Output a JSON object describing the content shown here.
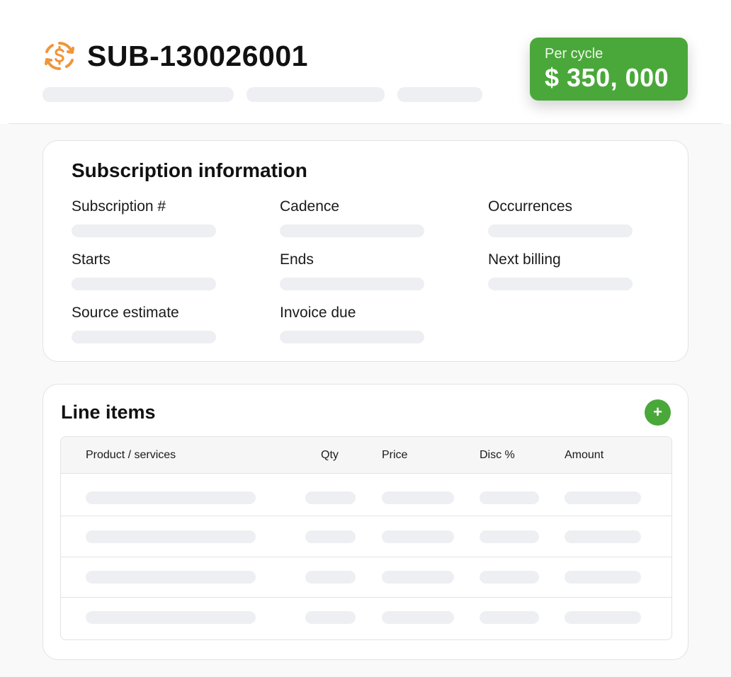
{
  "header": {
    "subscription_id": "SUB-130026001",
    "icon": "dollar-cycle-icon",
    "accent_color": "#f0953a"
  },
  "price_card": {
    "label": "Per cycle",
    "value": "$ 350, 000",
    "color": "#4aa83a"
  },
  "info": {
    "title": "Subscription information",
    "fields": [
      "Subscription #",
      "Cadence",
      "Occurrences",
      "Starts",
      "Ends",
      "Next billing",
      "Source estimate",
      "Invoice due"
    ]
  },
  "line_items": {
    "title": "Line items",
    "add_icon": "plus-icon",
    "add_label": "+",
    "columns": [
      "Product / services",
      "Qty",
      "Price",
      "Disc %",
      "Amount"
    ],
    "row_count": 4
  }
}
